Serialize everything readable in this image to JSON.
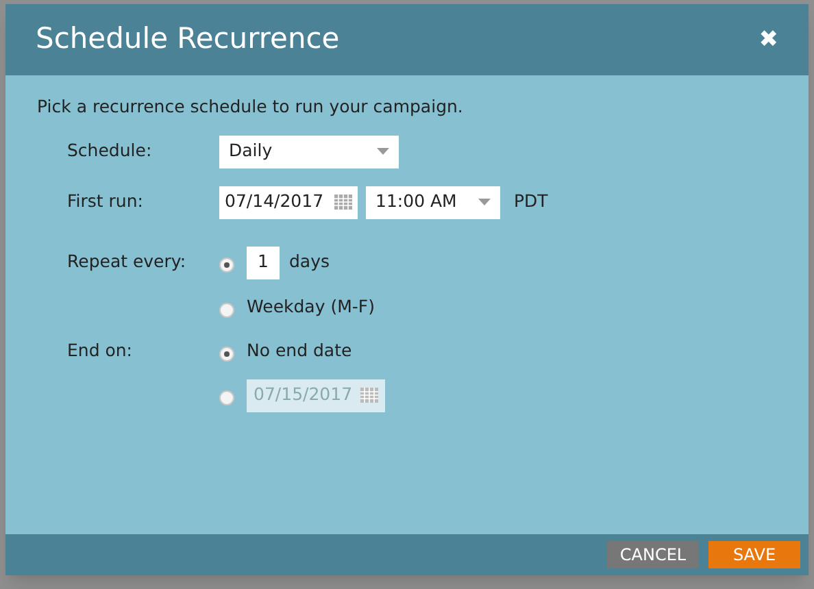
{
  "dialog": {
    "title": "Schedule Recurrence",
    "close": "✖",
    "intro": "Pick a recurrence schedule to run your campaign.",
    "schedule": {
      "label": "Schedule:",
      "value": "Daily"
    },
    "first_run": {
      "label": "First run:",
      "date": "07/14/2017",
      "time": "11:00 AM",
      "timezone": "PDT"
    },
    "repeat": {
      "label": "Repeat every:",
      "options": [
        {
          "kind": "count",
          "value": "1",
          "unit": "days",
          "selected": true
        },
        {
          "kind": "text",
          "text": "Weekday (M-F)",
          "selected": false
        }
      ]
    },
    "end": {
      "label": "End on:",
      "options": [
        {
          "kind": "text",
          "text": "No end date",
          "selected": true
        },
        {
          "kind": "date",
          "value": "07/15/2017",
          "disabled": true,
          "selected": false
        }
      ]
    },
    "buttons": [
      {
        "kind": "cancel",
        "label": "CANCEL"
      },
      {
        "kind": "save",
        "label": "SAVE"
      }
    ]
  }
}
